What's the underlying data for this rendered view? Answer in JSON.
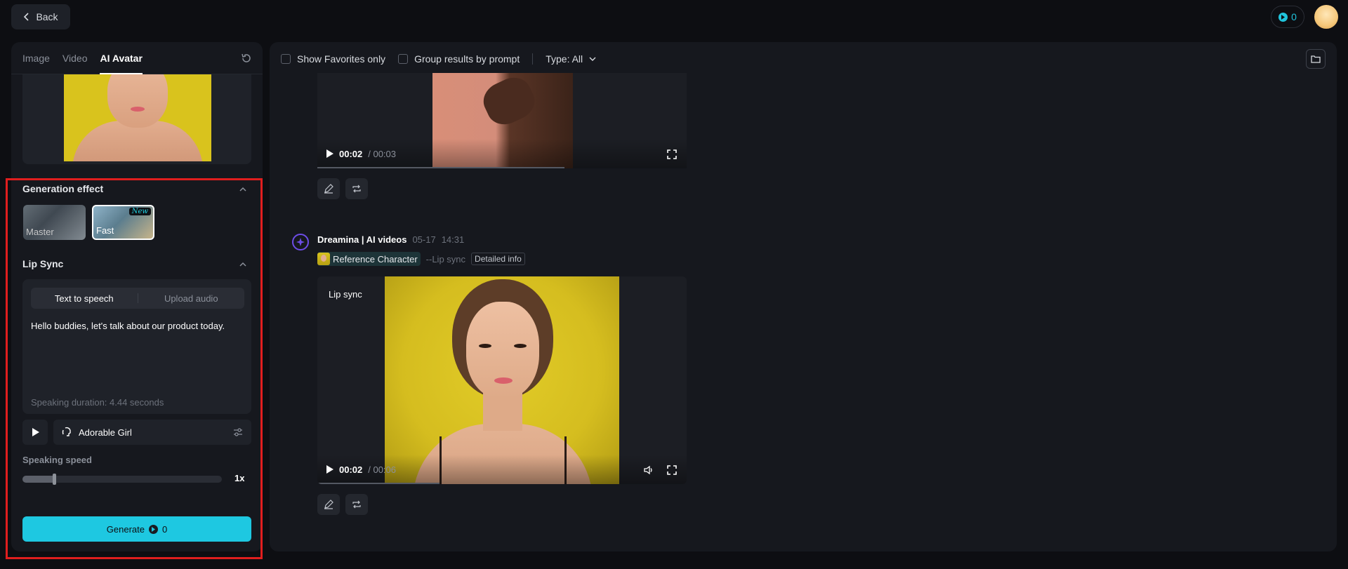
{
  "header": {
    "back_label": "Back",
    "credits": "0"
  },
  "left": {
    "tabs": [
      {
        "label": "Image",
        "active": false
      },
      {
        "label": "Video",
        "active": false
      },
      {
        "label": "AI Avatar",
        "active": true
      }
    ],
    "generation_effect": {
      "title": "Generation effect",
      "options": [
        {
          "label": "Master",
          "selected": false
        },
        {
          "label": "Fast",
          "selected": true,
          "badge": "New"
        }
      ]
    },
    "lip_sync": {
      "title": "Lip Sync",
      "modes": [
        "Text to speech",
        "Upload audio"
      ],
      "active_mode": "Text to speech",
      "text": "Hello buddies, let's talk about our product today.",
      "duration": "Speaking duration: 4.44 seconds",
      "voice": "Adorable Girl"
    },
    "speed": {
      "label": "Speaking speed",
      "value_label": "1x",
      "fraction": 0.16
    },
    "generate": {
      "label": "Generate",
      "cost": "0"
    }
  },
  "right": {
    "filters": {
      "favorites": "Show Favorites only",
      "group": "Group results by prompt",
      "type": "Type: All"
    },
    "video1": {
      "current": "00:02",
      "total": "/ 00:03",
      "progress": 0.67
    },
    "entry": {
      "author": "Dreamina | AI videos",
      "date": "05-17",
      "time": "14:31",
      "reference": "Reference Character",
      "tag": "--Lip sync",
      "detail": "Detailed info"
    },
    "video2": {
      "label": "Lip sync",
      "current": "00:02",
      "total": "/ 00:06",
      "progress": 0.33
    }
  },
  "colors": {
    "accent": "#1ec8e1",
    "highlight": "#e01e1e",
    "brand_icon": "#6d4de8"
  },
  "icons": [
    "chevron-left-icon",
    "coin-icon",
    "reset-icon",
    "chevron-up-icon",
    "play-icon",
    "voice-icon",
    "sliders-icon",
    "chevron-down-icon",
    "folder-icon",
    "fullscreen-icon",
    "volume-icon",
    "edit-icon",
    "loop-icon",
    "dreamina-logo-icon"
  ]
}
